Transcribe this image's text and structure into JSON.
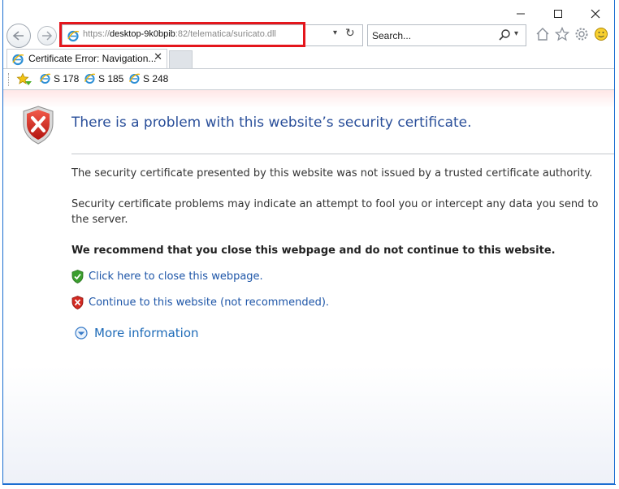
{
  "window": {
    "minimize_glyph": "—",
    "maximize_glyph": "☐",
    "close_glyph": "✕"
  },
  "address_bar": {
    "url_prefix": "https://",
    "url_domain": "desktop-9k0bpib",
    "url_path": ":82/telematica/suricato.dll",
    "dropdown_glyph": "▾",
    "refresh_glyph": "↻"
  },
  "search": {
    "placeholder": "Search...",
    "dropdown_glyph": "▾"
  },
  "tabs": [
    {
      "label": "Certificate Error: Navigation...",
      "close_glyph": "✕"
    }
  ],
  "favorites": [
    {
      "label": "S 178"
    },
    {
      "label": "S 185"
    },
    {
      "label": "S 248"
    }
  ],
  "page": {
    "title": "There is a problem with this website’s security certificate.",
    "paragraph1": "The security certificate presented by this website was not issued by a trusted certificate authority.",
    "paragraph2": "Security certificate problems may indicate an attempt to fool you or intercept any data you send to the server.",
    "recommendation": "We recommend that you close this webpage and do not continue to this website.",
    "close_link": "Click here to close this webpage.",
    "continue_link": "Continue to this website (not recommended).",
    "more_info": "More information"
  },
  "colors": {
    "highlight_box": "#e4161c",
    "title": "#2a4f9a",
    "link": "#1e56a8"
  }
}
